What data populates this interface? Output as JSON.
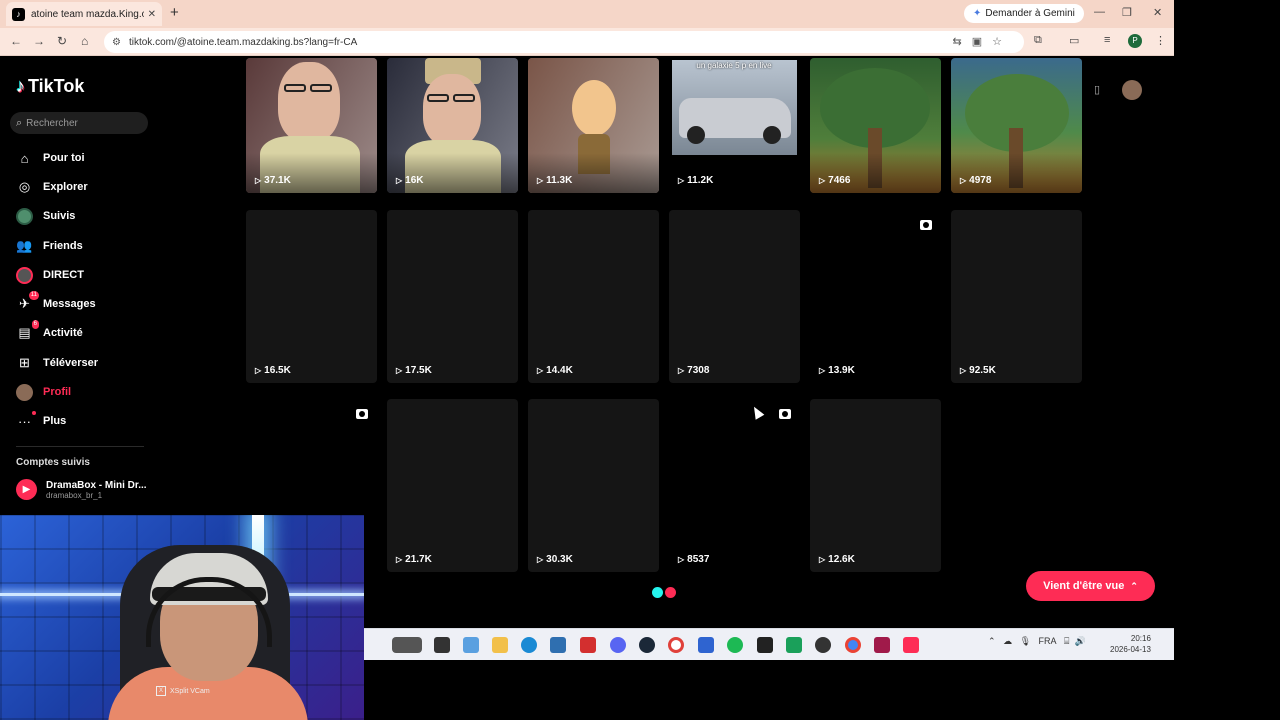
{
  "browser": {
    "tab_title": "atoine team mazda.King.of.vrai",
    "gemini_label": "Demander à Gemini",
    "url": "tiktok.com/@atoine.team.mazdaking.bs?lang=fr-CA",
    "profile_initial": "P"
  },
  "sidebar": {
    "logo_text": "TikTok",
    "search_placeholder": "Rechercher",
    "items": [
      {
        "label": "Pour toi",
        "icon": "home-icon"
      },
      {
        "label": "Explorer",
        "icon": "compass-icon"
      },
      {
        "label": "Suivis",
        "icon": "avatar-icon"
      },
      {
        "label": "Friends",
        "icon": "people-icon"
      },
      {
        "label": "DIRECT",
        "icon": "live-icon"
      },
      {
        "label": "Messages",
        "icon": "send-icon",
        "badge": "11"
      },
      {
        "label": "Activité",
        "icon": "activity-icon",
        "badge": "6"
      },
      {
        "label": "Téléverser",
        "icon": "upload-icon"
      },
      {
        "label": "Profil",
        "icon": "profile-avatar-icon",
        "active": true
      },
      {
        "label": "Plus",
        "icon": "more-icon"
      }
    ],
    "following_title": "Comptes suivis",
    "following": [
      {
        "name": "DramaBox - Mini Dr...",
        "handle": "dramabox_br_1"
      }
    ]
  },
  "grid": {
    "row1": [
      {
        "views": "37.1K"
      },
      {
        "views": "16K"
      },
      {
        "views": "11.3K"
      },
      {
        "views": "11.2K",
        "overlay": "un galaxie 5 p en live"
      },
      {
        "views": "7466"
      },
      {
        "views": "4978"
      }
    ],
    "row2": [
      {
        "views": "16.5K"
      },
      {
        "views": "17.5K"
      },
      {
        "views": "14.4K"
      },
      {
        "views": "7308"
      },
      {
        "views": "13.9K"
      },
      {
        "views": "92.5K"
      }
    ],
    "row3": [
      {
        "views": ""
      },
      {
        "views": "21.7K"
      },
      {
        "views": "30.3K"
      },
      {
        "views": "8537"
      },
      {
        "views": "12.6K"
      }
    ]
  },
  "pill_label": "Vient d'être vue",
  "taskbar": {
    "lang": "FRA",
    "time": "20:16",
    "date": "2026-04-13"
  },
  "webcam_label": "XSplit VCam",
  "colors": {
    "tiktok_red": "#fe2c55",
    "tiktok_cyan": "#25f4ee",
    "tab_strip": "#f5d6c8"
  }
}
